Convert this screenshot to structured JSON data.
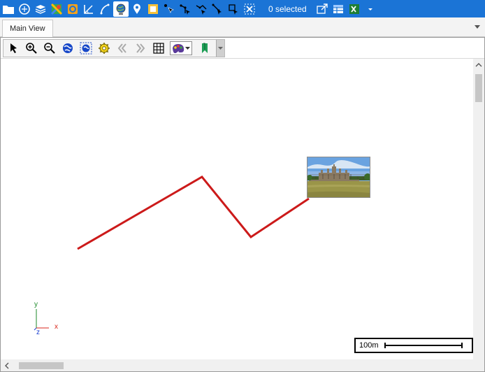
{
  "toolbar": {
    "selection_status": "0 selected",
    "buttons": [
      "open-folder",
      "open-workspace",
      "layers",
      "google-maps",
      "layer-toggle",
      "measure-angle",
      "measure-distance",
      "globe-view",
      "place-marker",
      "frame-select",
      "select-points",
      "select-line",
      "select-polyline",
      "select-segment",
      "clear-selection",
      "export-view",
      "table-view",
      "excel-export",
      "more-options"
    ]
  },
  "tabs": [
    {
      "label": "Main View",
      "active": true
    }
  ],
  "map_toolbar": {
    "tools": [
      "pointer",
      "zoom-in",
      "zoom-out",
      "full-extent",
      "zoom-to-selection",
      "settings",
      "previous-extent",
      "next-extent",
      "grid",
      "style-picker",
      "bookmark"
    ]
  },
  "map": {
    "route_color": "#cc1a1a",
    "route_vertices": [
      [
        110,
        355
      ],
      [
        288,
        252
      ],
      [
        358,
        338
      ],
      [
        441,
        283
      ]
    ],
    "axes": {
      "y_label": "y",
      "x_label": "x",
      "z_label": "z"
    },
    "scale_bar": {
      "label": "100m"
    }
  },
  "colors": {
    "toolbar_bg": "#1b74d6",
    "accent": "#ffffff"
  }
}
